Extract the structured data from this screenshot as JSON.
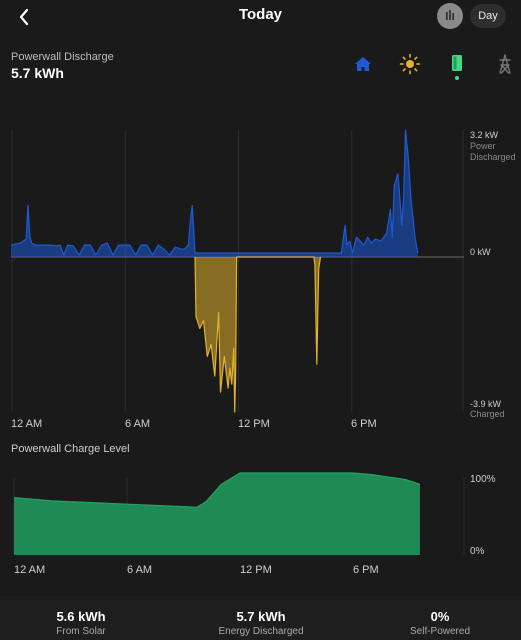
{
  "header": {
    "title": "Today",
    "period": "Day"
  },
  "summary": {
    "label": "Powerwall Discharge",
    "value": "5.7 kWh"
  },
  "sources": [
    {
      "name": "home",
      "icon": "home-icon",
      "color": "#1e5ad6"
    },
    {
      "name": "solar",
      "icon": "sun-icon",
      "color": "#e2b32b"
    },
    {
      "name": "powerwall",
      "icon": "powerwall-icon",
      "color": "#3ddc84",
      "active": true
    },
    {
      "name": "grid",
      "icon": "grid-tower-icon",
      "color": "#777777"
    }
  ],
  "power_chart": {
    "ylabel_top_value": "3.2 kW",
    "ylabel_top_text_1": "Power",
    "ylabel_top_text_2": "Discharged",
    "ylabel_zero": "0 kW",
    "ylabel_bottom_value": "-3.9 kW",
    "ylabel_bottom_text": "Charged",
    "x_ticks": [
      "12 AM",
      "6 AM",
      "12 PM",
      "6 PM"
    ]
  },
  "charge_section": {
    "label": "Powerwall Charge Level",
    "y_top": "100%",
    "y_bottom": "0%",
    "x_ticks": [
      "12 AM",
      "6 AM",
      "12 PM",
      "6 PM"
    ]
  },
  "footer": [
    {
      "value": "5.6 kWh",
      "label": "From Solar"
    },
    {
      "value": "5.7 kWh",
      "label": "Energy Discharged"
    },
    {
      "value": "0%",
      "label": "Self-Powered"
    }
  ],
  "colors": {
    "discharge": "#1e5ad6",
    "charge": "#e2b32b",
    "level": "#1f8a56"
  },
  "chart_data": [
    {
      "type": "area",
      "title": "Powerwall Discharge",
      "x_unit": "hour of day",
      "xlim": [
        0,
        24
      ],
      "ylim": [
        -3.9,
        3.2
      ],
      "y_unit": "kW",
      "series": [
        {
          "color": "#1e5ad6",
          "x": [
            0,
            0.5,
            0.8,
            0.9,
            1.0,
            1.1,
            1.3,
            1.6,
            2.0,
            2.4,
            2.6,
            2.8,
            3.0,
            3.3,
            3.6,
            3.9,
            4.2,
            4.5,
            4.8,
            5.1,
            5.4,
            5.7,
            6.0,
            6.3,
            6.6,
            6.9,
            7.2,
            7.5,
            7.8,
            8.1,
            8.4,
            8.7,
            9.0,
            9.2,
            9.4,
            9.5,
            9.6,
            9.75,
            17.5,
            17.7,
            17.8,
            17.95,
            18.1,
            18.3,
            18.5,
            18.7,
            18.9,
            19.1,
            19.3,
            19.6,
            19.9,
            20.1,
            20.2,
            20.3,
            20.5,
            20.6,
            20.7,
            20.8,
            20.9,
            21.05,
            21.2,
            21.3,
            21.4,
            21.55
          ],
          "y": [
            0.3,
            0.35,
            0.45,
            1.3,
            0.5,
            0.35,
            0.3,
            0.3,
            0.3,
            0.28,
            0.3,
            0.05,
            0.3,
            0.28,
            0.05,
            0.3,
            0.3,
            0.05,
            0.3,
            0.35,
            0.05,
            0.3,
            0.3,
            0.3,
            0.05,
            0.3,
            0.3,
            0.05,
            0.3,
            0.2,
            0.05,
            0.25,
            0.2,
            0.2,
            0.3,
            0.9,
            1.3,
            0.1,
            0.1,
            0.8,
            0.3,
            0.4,
            0.1,
            0.5,
            0.4,
            0.3,
            0.5,
            0.35,
            0.45,
            0.4,
            0.6,
            1.2,
            0.5,
            1.8,
            2.1,
            1.5,
            0.8,
            1.5,
            3.2,
            2.5,
            1.4,
            1.0,
            0.5,
            0.1
          ]
        },
        {
          "color": "#e2b32b",
          "x": [
            9.75,
            9.8,
            10.0,
            10.2,
            10.4,
            10.6,
            10.8,
            11.0,
            11.1,
            11.3,
            11.5,
            11.6,
            11.7,
            11.8,
            11.85,
            11.9,
            11.95,
            16.05,
            16.1,
            16.2,
            16.3,
            16.4
          ],
          "y": [
            0,
            -1.5,
            -1.8,
            -1.6,
            -2.5,
            -2.2,
            -3.0,
            -1.4,
            -3.4,
            -2.5,
            -3.3,
            -2.8,
            -3.2,
            -2.3,
            -3.9,
            -3.0,
            0,
            0,
            -0.2,
            -2.7,
            -0.3,
            0
          ]
        }
      ]
    },
    {
      "type": "area",
      "title": "Powerwall Charge Level",
      "x_unit": "hour of day",
      "xlim": [
        0,
        24
      ],
      "ylim": [
        0,
        100
      ],
      "y_unit": "%",
      "series": [
        {
          "color": "#1f8a56",
          "x": [
            0,
            1,
            2,
            3,
            4,
            5,
            6,
            7,
            8,
            9,
            9.7,
            10.2,
            11,
            12,
            12.4,
            13,
            14,
            15,
            16,
            17,
            18,
            19,
            19.6,
            20.2,
            20.8,
            21.3,
            21.55
          ],
          "y": [
            70,
            68,
            66,
            65,
            64,
            63,
            62,
            61,
            60,
            59,
            58,
            65,
            86,
            100,
            100,
            100,
            100,
            100,
            100,
            100,
            100,
            98,
            96,
            94,
            92,
            88,
            86
          ]
        }
      ]
    }
  ]
}
